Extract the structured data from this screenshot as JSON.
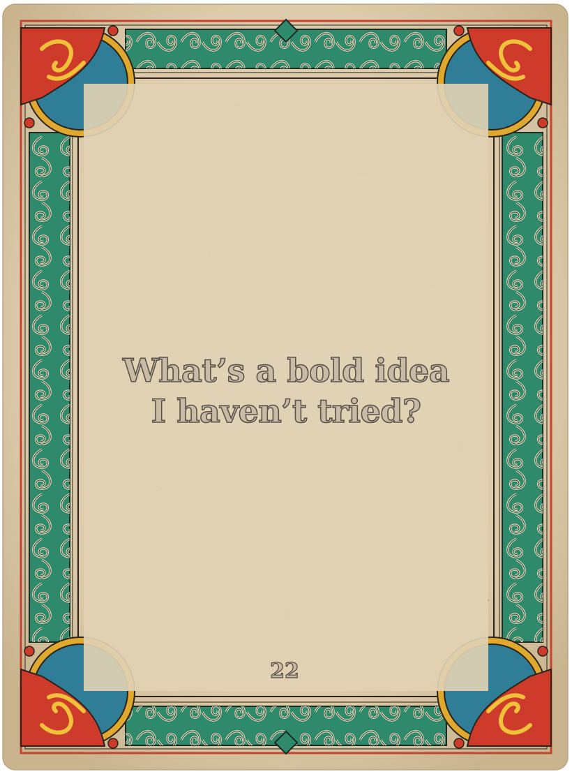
{
  "card": {
    "prompt_line_1": "What’s a bold idea",
    "prompt_line_2": "I haven’t tried?",
    "number": "22"
  },
  "colors": {
    "paper": "#e2d3b7",
    "paper_edge": "#c9b794",
    "border_green": "#2f8a6c",
    "border_red": "#cf3b2a",
    "border_blue": "#2f7d96",
    "border_gold": "#e0a92e",
    "ink": "#3a3128"
  },
  "icons": [
    "ornate-border",
    "corner-ornament-top-left",
    "corner-ornament-top-right",
    "corner-ornament-bottom-left",
    "corner-ornament-bottom-right"
  ]
}
